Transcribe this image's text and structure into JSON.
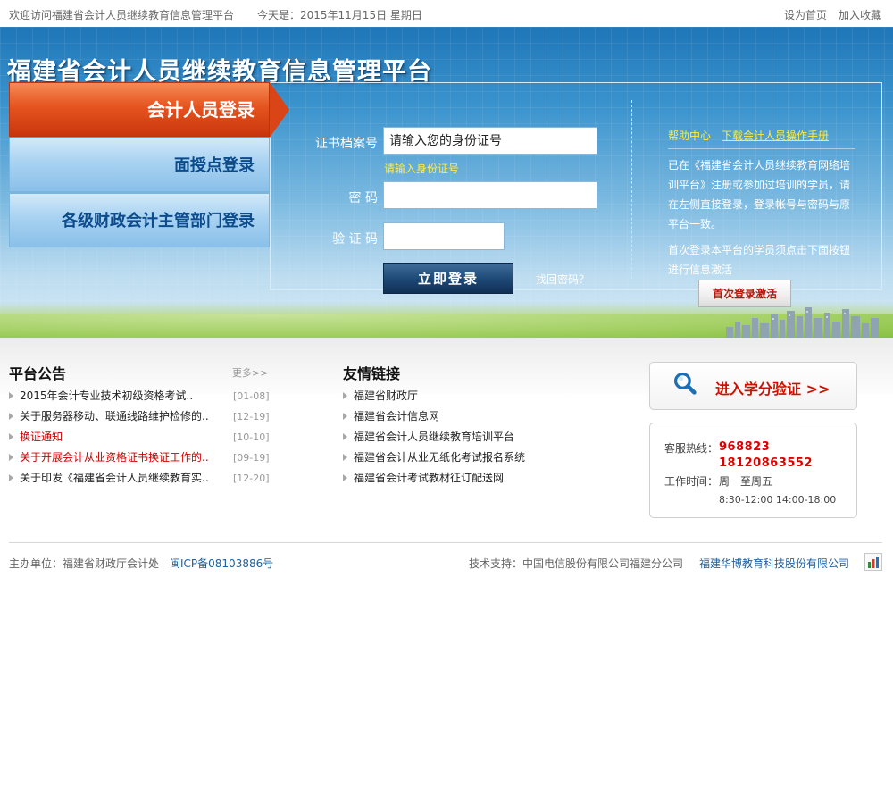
{
  "topbar": {
    "welcome": "欢迎访问福建省会计人员继续教育信息管理平台",
    "today": "今天是：2015年11月15日 星期日",
    "set_home": "设为首页",
    "add_fav": "加入收藏"
  },
  "banner": {
    "title": "福建省会计人员继续教育信息管理平台"
  },
  "tabs": {
    "accountant": "会计人员登录",
    "teaching_point": "面授点登录",
    "finance_dept": "各级财政会计主管部门登录"
  },
  "form": {
    "cert_label": "证书档案号",
    "cert_placeholder": "请输入您的身份证号",
    "cert_hint": "请输入身份证号",
    "password_label": "密 码",
    "captcha_label": "验 证 码",
    "login_button": "立即登录",
    "forgot": "找回密码？"
  },
  "help": {
    "title": "帮助中心",
    "manual_link": "下载会计人员操作手册",
    "text1": "已在《福建省会计人员继续教育网络培训平台》注册或参加过培训的学员，请在左侧直接登录，登录帐号与密码与原平台一致。",
    "text2": "首次登录本平台的学员须点击下面按钮进行信息激活",
    "activate_button": "首次登录激活"
  },
  "announcements": {
    "title": "平台公告",
    "more": "更多>>",
    "items": [
      {
        "text": "2015年会计专业技术初级资格考试..",
        "date": "[01-08]"
      },
      {
        "text": "关于服务器移动、联通线路维护检修的..",
        "date": "[12-19]"
      },
      {
        "text": "换证通知",
        "date": "[10-10]"
      },
      {
        "text": "关于开展会计从业资格证书换证工作的..",
        "date": "[09-19]"
      },
      {
        "text": "关于印发《福建省会计人员继续教育实..",
        "date": "[12-20]"
      }
    ]
  },
  "links": {
    "title": "友情链接",
    "items": [
      {
        "text": "福建省财政厅"
      },
      {
        "text": "福建省会计信息网"
      },
      {
        "text": "福建省会计人员继续教育培训平台"
      },
      {
        "text": "福建省会计从业无纸化考试报名系统"
      },
      {
        "text": "福建省会计考试教材征订配送网"
      }
    ]
  },
  "credit": {
    "label": "进入学分验证 >>"
  },
  "hotline": {
    "label": "客服热线：",
    "numbers": "968823  18120863552",
    "work_label": "工作时间：",
    "work_days": "周一至周五",
    "work_hours": "8:30-12:00 14:00-18:00"
  },
  "footer": {
    "host": "主办单位：福建省财政厅会计处",
    "icp": "闽ICP备08103886号",
    "tech": "技术支持：中国电信股份有限公司福建分公司",
    "company": "福建华博教育科技股份有限公司"
  },
  "colors": {
    "active_tab": "#e5541f",
    "inactive_tab": "#a8d2f1",
    "hint_yellow": "#ffec3d",
    "hotline_red": "#dd0000"
  },
  "icons": [
    "magnifier-icon",
    "list-arrow-icon",
    "cnzz-stat-icon"
  ]
}
